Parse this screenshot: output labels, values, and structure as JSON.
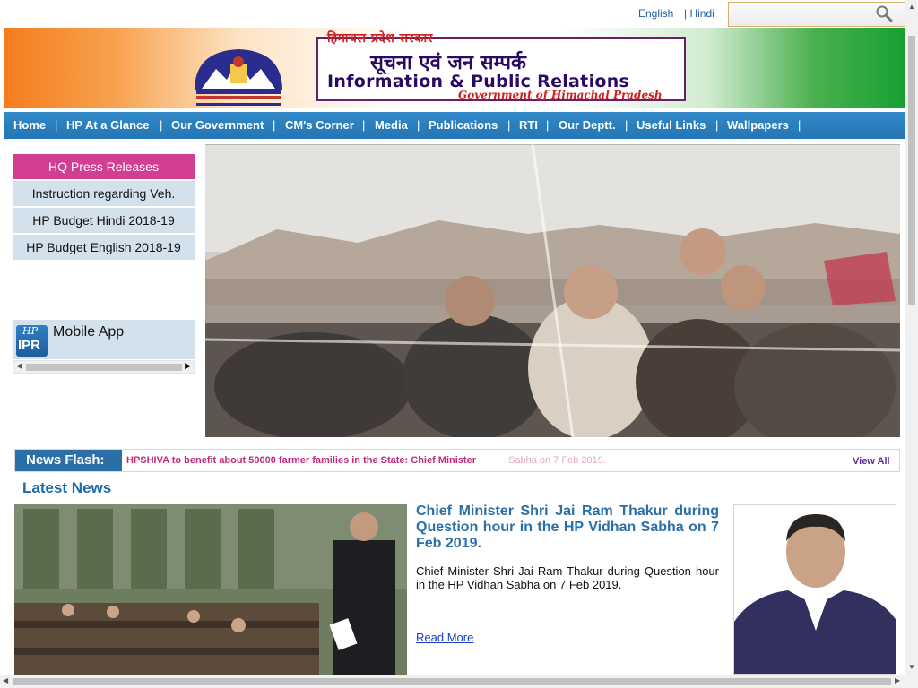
{
  "header": {
    "lang_english": "English",
    "lang_hindi": "| Hindi",
    "search_placeholder": "",
    "search_icon": "search-icon"
  },
  "banner": {
    "hindi_state": "हिमाचल प्रदेश सरकार",
    "hindi_dept": "सूचना एवं जन सम्पर्क",
    "english_dept": "Information & Public Relations",
    "gov_line": "Government of Himachal Pradesh",
    "emblem_caption": "हिमाचल प्रदेश सरकार"
  },
  "nav": {
    "items": [
      {
        "label": "Home"
      },
      {
        "label": "HP At a Glance"
      },
      {
        "label": "Our Government"
      },
      {
        "label": "CM's Corner"
      },
      {
        "label": "Media"
      },
      {
        "label": "Publications"
      },
      {
        "label": "RTI"
      },
      {
        "label": "Our Deptt."
      },
      {
        "label": "Useful Links"
      },
      {
        "label": "Wallpapers"
      }
    ],
    "separator": "|"
  },
  "sidebar": {
    "items": [
      {
        "label": "HQ Press Releases"
      },
      {
        "label": "Instruction regarding Veh."
      },
      {
        "label": "HP Budget Hindi 2018-19"
      },
      {
        "label": "HP Budget English 2018-19"
      }
    ],
    "mobile_app": {
      "icon_top": "HP",
      "icon_bottom": "IPR",
      "label": "Mobile App"
    }
  },
  "news_flash": {
    "label": "News Flash:",
    "text": "HPSHIVA to benefit about 50000 farmer families in the State: Chief Minister",
    "ghost_text": "Sabha on 7 Feb 2019.",
    "view_all": "View All"
  },
  "latest_news": {
    "title": "Latest News",
    "headline": "Chief Minister Shri Jai Ram Thakur during Question hour in the HP Vidhan Sabha on 7 Feb 2019.",
    "body": "Chief Minister Shri Jai Ram Thakur during Question hour in the HP Vidhan Sabha on 7 Feb 2019.",
    "read_more": "Read More"
  },
  "colors": {
    "nav_blue": "#2a7fc0",
    "active_pink": "#d23f92",
    "side_bg": "#d3e1ec",
    "headline_blue": "#2a6fa8",
    "flash_pink": "#c02b7f"
  }
}
